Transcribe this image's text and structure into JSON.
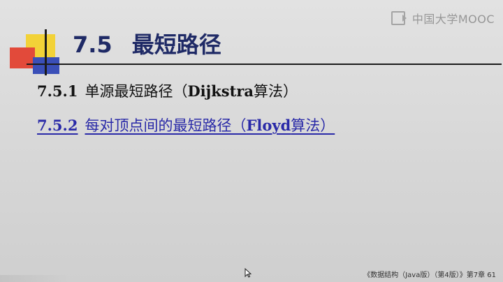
{
  "watermark": {
    "text": "中国大学MOOC",
    "icon": "play-box-icon"
  },
  "slide": {
    "title_num": "7.5",
    "title_text": "最短路径",
    "items": [
      {
        "code": "7.5.1",
        "text_prefix": "单源最短路径（",
        "text_latin": "Dijkstra",
        "text_suffix": "算法）"
      },
      {
        "code": "7.5.2",
        "text_prefix": "每对顶点间的最短路径（",
        "text_latin": "Floyd",
        "text_suffix": "算法）"
      }
    ],
    "footer": "《数据结构（Java版）（第4版）》第7章 61"
  },
  "colors": {
    "title": "#1f2a66",
    "link": "#2a2aa8",
    "deco_yellow": "#f2d238",
    "deco_red": "#e24a3a",
    "deco_blue": "#3a4fb8"
  }
}
